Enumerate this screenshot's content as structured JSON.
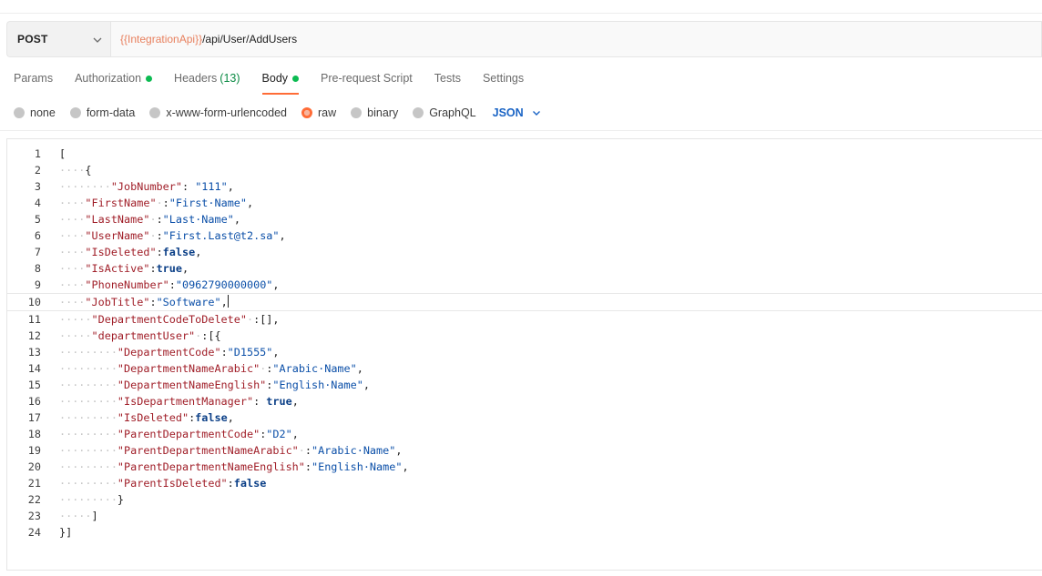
{
  "request": {
    "method": "POST",
    "url_variable": "{{IntegrationApi}}",
    "url_path": "/api/User/AddUsers"
  },
  "tabs": [
    {
      "label": "Params"
    },
    {
      "label": "Authorization",
      "dot": true
    },
    {
      "label": "Headers",
      "count": "(13)"
    },
    {
      "label": "Body",
      "dot": true,
      "active": true
    },
    {
      "label": "Pre-request Script"
    },
    {
      "label": "Tests"
    },
    {
      "label": "Settings"
    }
  ],
  "body_types": [
    {
      "label": "none"
    },
    {
      "label": "form-data"
    },
    {
      "label": "x-www-form-urlencoded"
    },
    {
      "label": "raw",
      "selected": true
    },
    {
      "label": "binary"
    },
    {
      "label": "GraphQL"
    }
  ],
  "format_select": "JSON",
  "editor": {
    "lines": [
      {
        "n": "1",
        "t": [
          [
            "p",
            "["
          ]
        ]
      },
      {
        "n": "2",
        "t": [
          [
            "w",
            "····"
          ],
          [
            "p",
            "{"
          ]
        ]
      },
      {
        "n": "3",
        "t": [
          [
            "w",
            "········"
          ],
          [
            "k",
            "\"JobNumber\""
          ],
          [
            "p",
            ": "
          ],
          [
            "s",
            "\"111\""
          ],
          [
            "p",
            ","
          ]
        ]
      },
      {
        "n": "4",
        "t": [
          [
            "w",
            "····"
          ],
          [
            "k",
            "\"FirstName\""
          ],
          [
            "w",
            "·"
          ],
          [
            "p",
            ":"
          ],
          [
            "s",
            "\"First·Name\""
          ],
          [
            "p",
            ","
          ]
        ]
      },
      {
        "n": "5",
        "t": [
          [
            "w",
            "····"
          ],
          [
            "k",
            "\"LastName\""
          ],
          [
            "w",
            "·"
          ],
          [
            "p",
            ":"
          ],
          [
            "s",
            "\"Last·Name\""
          ],
          [
            "p",
            ","
          ]
        ]
      },
      {
        "n": "6",
        "t": [
          [
            "w",
            "····"
          ],
          [
            "k",
            "\"UserName\""
          ],
          [
            "w",
            "·"
          ],
          [
            "p",
            ":"
          ],
          [
            "s",
            "\"First.Last@t2.sa\""
          ],
          [
            "p",
            ","
          ]
        ]
      },
      {
        "n": "7",
        "t": [
          [
            "w",
            "····"
          ],
          [
            "k",
            "\"IsDeleted\""
          ],
          [
            "p",
            ":"
          ],
          [
            "b",
            "false"
          ],
          [
            "p",
            ","
          ]
        ]
      },
      {
        "n": "8",
        "t": [
          [
            "w",
            "····"
          ],
          [
            "k",
            "\"IsActive\""
          ],
          [
            "p",
            ":"
          ],
          [
            "b",
            "true"
          ],
          [
            "p",
            ","
          ]
        ]
      },
      {
        "n": "9",
        "t": [
          [
            "w",
            "····"
          ],
          [
            "k",
            "\"PhoneNumber\""
          ],
          [
            "p",
            ":"
          ],
          [
            "s",
            "\"0962790000000\""
          ],
          [
            "p",
            ","
          ]
        ]
      },
      {
        "n": "10",
        "t": [
          [
            "w",
            "····"
          ],
          [
            "k",
            "\"JobTitle\""
          ],
          [
            "p",
            ":"
          ],
          [
            "s",
            "\"Software\""
          ],
          [
            "p",
            ","
          ]
        ],
        "current": true
      },
      {
        "n": "11",
        "t": [
          [
            "w",
            "·····"
          ],
          [
            "k",
            "\"DepartmentCodeToDelete\""
          ],
          [
            "w",
            "·"
          ],
          [
            "p",
            ":[],"
          ]
        ]
      },
      {
        "n": "12",
        "t": [
          [
            "w",
            "·····"
          ],
          [
            "k",
            "\"departmentUser\""
          ],
          [
            "w",
            "·"
          ],
          [
            "p",
            ":[{"
          ]
        ]
      },
      {
        "n": "13",
        "t": [
          [
            "w",
            "·········"
          ],
          [
            "k",
            "\"DepartmentCode\""
          ],
          [
            "p",
            ":"
          ],
          [
            "s",
            "\"D1555\""
          ],
          [
            "p",
            ","
          ]
        ]
      },
      {
        "n": "14",
        "t": [
          [
            "w",
            "·········"
          ],
          [
            "k",
            "\"DepartmentNameArabic\""
          ],
          [
            "w",
            "·"
          ],
          [
            "p",
            ":"
          ],
          [
            "s",
            "\"Arabic·Name\""
          ],
          [
            "p",
            ","
          ]
        ]
      },
      {
        "n": "15",
        "t": [
          [
            "w",
            "·········"
          ],
          [
            "k",
            "\"DepartmentNameEnglish\""
          ],
          [
            "p",
            ":"
          ],
          [
            "s",
            "\"English·Name\""
          ],
          [
            "p",
            ","
          ]
        ]
      },
      {
        "n": "16",
        "t": [
          [
            "w",
            "·········"
          ],
          [
            "k",
            "\"IsDepartmentManager\""
          ],
          [
            "p",
            ": "
          ],
          [
            "b",
            "true"
          ],
          [
            "p",
            ","
          ]
        ]
      },
      {
        "n": "17",
        "t": [
          [
            "w",
            "·········"
          ],
          [
            "k",
            "\"IsDeleted\""
          ],
          [
            "p",
            ":"
          ],
          [
            "b",
            "false"
          ],
          [
            "p",
            ","
          ]
        ]
      },
      {
        "n": "18",
        "t": [
          [
            "w",
            "·········"
          ],
          [
            "k",
            "\"ParentDepartmentCode\""
          ],
          [
            "p",
            ":"
          ],
          [
            "s",
            "\"D2\""
          ],
          [
            "p",
            ","
          ]
        ]
      },
      {
        "n": "19",
        "t": [
          [
            "w",
            "·········"
          ],
          [
            "k",
            "\"ParentDepartmentNameArabic\""
          ],
          [
            "w",
            "·"
          ],
          [
            "p",
            ":"
          ],
          [
            "s",
            "\"Arabic·Name\""
          ],
          [
            "p",
            ","
          ]
        ]
      },
      {
        "n": "20",
        "t": [
          [
            "w",
            "·········"
          ],
          [
            "k",
            "\"ParentDepartmentNameEnglish\""
          ],
          [
            "p",
            ":"
          ],
          [
            "s",
            "\"English·Name\""
          ],
          [
            "p",
            ","
          ]
        ]
      },
      {
        "n": "21",
        "t": [
          [
            "w",
            "·········"
          ],
          [
            "k",
            "\"ParentIsDeleted\""
          ],
          [
            "p",
            ":"
          ],
          [
            "b",
            "false"
          ]
        ]
      },
      {
        "n": "22",
        "t": [
          [
            "w",
            "·········"
          ],
          [
            "p",
            "}"
          ]
        ]
      },
      {
        "n": "23",
        "t": [
          [
            "w",
            "·····"
          ],
          [
            "p",
            "]"
          ]
        ]
      },
      {
        "n": "24",
        "t": [
          [
            "p",
            "}]"
          ]
        ]
      }
    ]
  }
}
